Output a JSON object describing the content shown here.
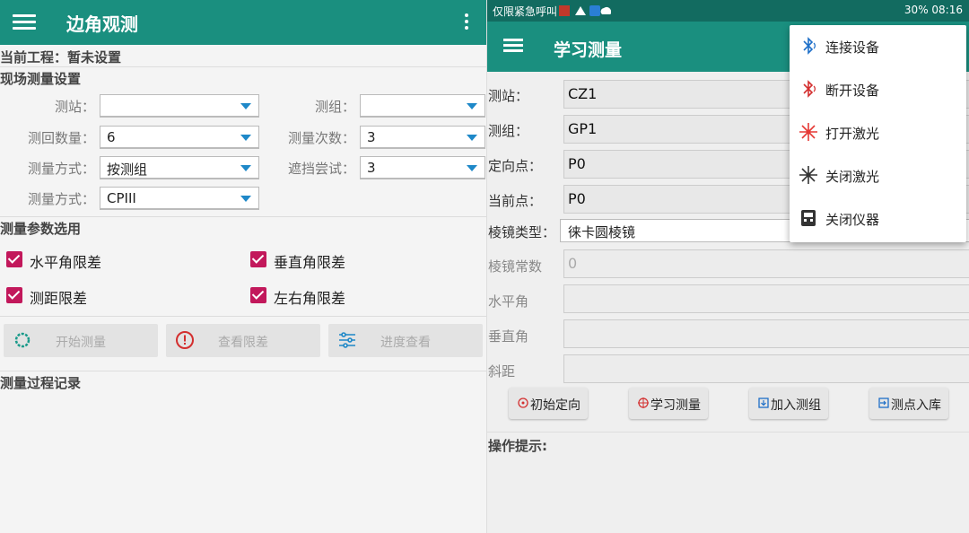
{
  "left": {
    "title": "边角观测",
    "project": "当前工程：暂未设置",
    "section_settings": "现场测量设置",
    "fields": {
      "station_label": "测站：",
      "station_value": "",
      "group_label": "测组：",
      "group_value": "",
      "rounds_label": "测回数量：",
      "rounds_value": "6",
      "times_label": "测量次数：",
      "times_value": "3",
      "method_label": "测量方式：",
      "method_value": "按测组",
      "occlusion_label": "遮挡尝试：",
      "occlusion_value": "3",
      "method2_label": "测量方式：",
      "method2_value": "CPIII"
    },
    "section_params": "测量参数选用",
    "checkboxes": {
      "horizontal": "水平角限差",
      "vertical": "垂直角限差",
      "distance": "测距限差",
      "leftright": "左右角限差"
    },
    "buttons": {
      "start": "开始测量",
      "check": "查看限差",
      "progress": "进度查看"
    },
    "section_log": "测量过程记录"
  },
  "right": {
    "status_left": "仅限紧急呼叫",
    "status_right": "30% 08:16",
    "title": "学习测量",
    "fields": {
      "station_label": "测站：",
      "station_value": "CZ1",
      "group_label": "测组：",
      "group_value": "GP1",
      "orient_label": "定向点：",
      "orient_value": "P0",
      "current_label": "当前点：",
      "current_value": "P0",
      "prism_label": "棱镜类型：",
      "prism_value": "徕卡圆棱镜",
      "prism_const_label": "棱镜常数",
      "prism_const_value": "0",
      "hz_label": "水平角",
      "hz_value": "",
      "v_label": "垂直角",
      "v_value": "",
      "sd_label": "斜距",
      "sd_value": ""
    },
    "buttons": {
      "init_orient": "初始定向",
      "learn": "学习测量",
      "add_group": "加入测组",
      "store": "测点入库"
    },
    "hint_label": "操作提示:"
  },
  "popup": {
    "connect": "连接设备",
    "disconnect": "断开设备",
    "laser_on": "打开激光",
    "laser_off": "关闭激光",
    "shutdown": "关闭仪器"
  },
  "colors": {
    "appbar": "#1a8f7f",
    "statusbar": "#126b60",
    "checkbox": "#c2185b",
    "spinner_arrow": "#1e88c8"
  }
}
